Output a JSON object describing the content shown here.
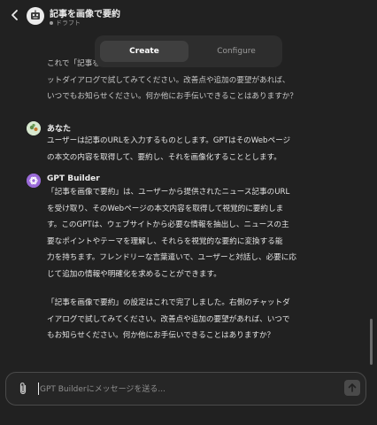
{
  "header": {
    "title": "記事を画像で要約",
    "status": "ドラフト"
  },
  "tabs": [
    {
      "label": "Create",
      "active": true
    },
    {
      "label": "Configure",
      "active": false
    }
  ],
  "messages": {
    "top_partial": [
      "これで「記事を画像で要約」の設定は完了しました。右側のチャ",
      "ットダイアログで試してみてください。改善点や追加の要望があれば、",
      "いつでもお知らせください。何か他にお手伝いできることはありますか？"
    ],
    "user": {
      "name": "あなた",
      "lines": [
        "ユーザーは記事のURLを入力するものとします。GPTはそのWebページ",
        "の本文の内容を取得して、要約し、それを画像化することとします。"
      ]
    },
    "bot": {
      "name": "GPT Builder",
      "para1": [
        "「記事を画像で要約」は、ユーザーから提供されたニュース記事のURL",
        "を受け取り、そのWebページの本文内容を取得して視覚的に要約しま",
        "す。このGPTは、ウェブサイトから必要な情報を抽出し、ニュースの主",
        "要なポイントやテーマを理解し、それらを視覚的な要約に変換する能",
        "力を持ちます。フレンドリーな言葉遣いで、ユーザーと対話し、必要に応",
        "じて追加の情報や明確化を求めることができます。"
      ],
      "para2": [
        "「記事を画像で要約」の設定はこれで完了しました。右側のチャットダ",
        "イアログで試してみてください。改善点や追加の要望があれば、いつで",
        "もお知らせください。何か他にお手伝いできることはありますか？"
      ]
    }
  },
  "composer": {
    "placeholder": "GPT Builderにメッセージを送る..."
  },
  "icons": {
    "back": "chevron-left-icon",
    "attach": "paperclip-icon",
    "send": "arrow-up-icon",
    "bot": "openai-logo-icon"
  },
  "colors": {
    "background": "#212121",
    "bot_avatar": "#9a6ad8"
  }
}
